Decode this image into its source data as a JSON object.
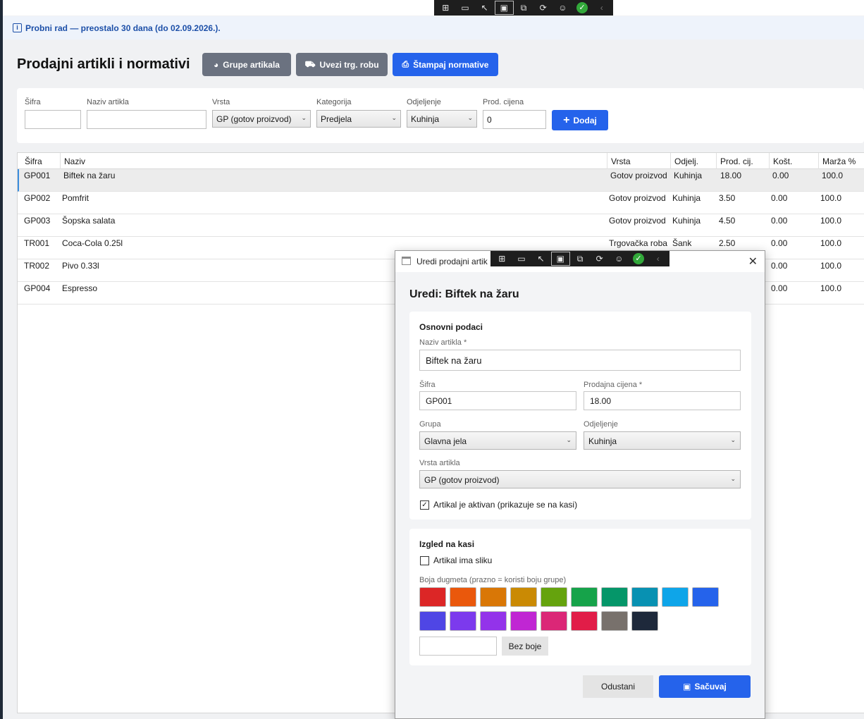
{
  "trial_banner": {
    "text": "Probni rad — preostalo 30 dana (do 02.09.2026.)."
  },
  "header": {
    "title": "Prodajni artikli i normativi",
    "groups_button": "Grupe artikala",
    "import_button": "Uvezi trg. robu",
    "print_button": "Štampaj normative"
  },
  "filter": {
    "sifra_label": "Šifra",
    "sifra_value": "",
    "naziv_label": "Naziv artikla",
    "naziv_value": "",
    "vrsta_label": "Vrsta",
    "vrsta_value": "GP (gotov proizvod)",
    "kategorija_label": "Kategorija",
    "kategorija_value": "Predjela",
    "odjeljenje_label": "Odjeljenje",
    "odjeljenje_value": "Kuhinja",
    "cijena_label": "Prod. cijena",
    "cijena_value": "0",
    "add_button": "Dodaj"
  },
  "table": {
    "columns": [
      "Šifra",
      "Naziv",
      "Vrsta",
      "Odjelj.",
      "Prod. cij.",
      "Košt.",
      "Marža %"
    ],
    "rows": [
      [
        "GP001",
        "Biftek na žaru",
        "Gotov proizvod",
        "Kuhinja",
        "18.00",
        "0.00",
        "100.0"
      ],
      [
        "GP002",
        "Pomfrit",
        "Gotov proizvod",
        "Kuhinja",
        "3.50",
        "0.00",
        "100.0"
      ],
      [
        "GP003",
        "Šopska salata",
        "Gotov proizvod",
        "Kuhinja",
        "4.50",
        "0.00",
        "100.0"
      ],
      [
        "TR001",
        "Coca-Cola 0.25l",
        "Trgovačka roba",
        "Šank",
        "2.50",
        "0.00",
        "100.0"
      ],
      [
        "TR002",
        "Pivo 0.33l",
        "",
        "",
        "",
        "0.00",
        "100.0"
      ],
      [
        "GP004",
        "Espresso",
        "",
        "",
        "",
        "0.00",
        "100.0"
      ]
    ],
    "selected_row": 0
  },
  "dialog": {
    "window_title": "Uredi prodajni artik",
    "heading": "Uredi: Biftek na žaru",
    "basic_section_title": "Osnovni podaci",
    "naziv_label": "Naziv artikla *",
    "naziv_value": "Biftek na žaru",
    "sifra_label": "Šifra",
    "sifra_value": "GP001",
    "cijena_label": "Prodajna cijena *",
    "cijena_value": "18.00",
    "grupa_label": "Grupa",
    "grupa_value": "Glavna jela",
    "odjeljenje_label": "Odjeljenje",
    "odjeljenje_value": "Kuhinja",
    "vrsta_label": "Vrsta artikla",
    "vrsta_value": "GP (gotov proizvod)",
    "active_label": "Artikal je aktivan (prikazuje se na kasi)",
    "active_checked": true,
    "appearance_section_title": "Izgled na kasi",
    "has_image_label": "Artikal ima sliku",
    "has_image_checked": false,
    "color_label": "Boja dugmeta (prazno = koristi boju grupe)",
    "colors": [
      "#dc2626",
      "#ea580c",
      "#d97706",
      "#ca8a04",
      "#65a30d",
      "#16a34a",
      "#059669",
      "#0891b2",
      "#0ea5e9",
      "#2563eb",
      "#4f46e5",
      "#7c3aed",
      "#9333ea",
      "#c026d3",
      "#db2777",
      "#e11d48",
      "#78716c",
      "#1e293b"
    ],
    "color_value": "",
    "no_color_button": "Bez boje",
    "cancel_button": "Odustani",
    "save_button": "Sačuvaj"
  },
  "colors": {
    "accent": "#2563eb",
    "gray_button": "#6b7280",
    "trial_text": "#1c4fa8",
    "trial_bg": "#eef3fb"
  }
}
